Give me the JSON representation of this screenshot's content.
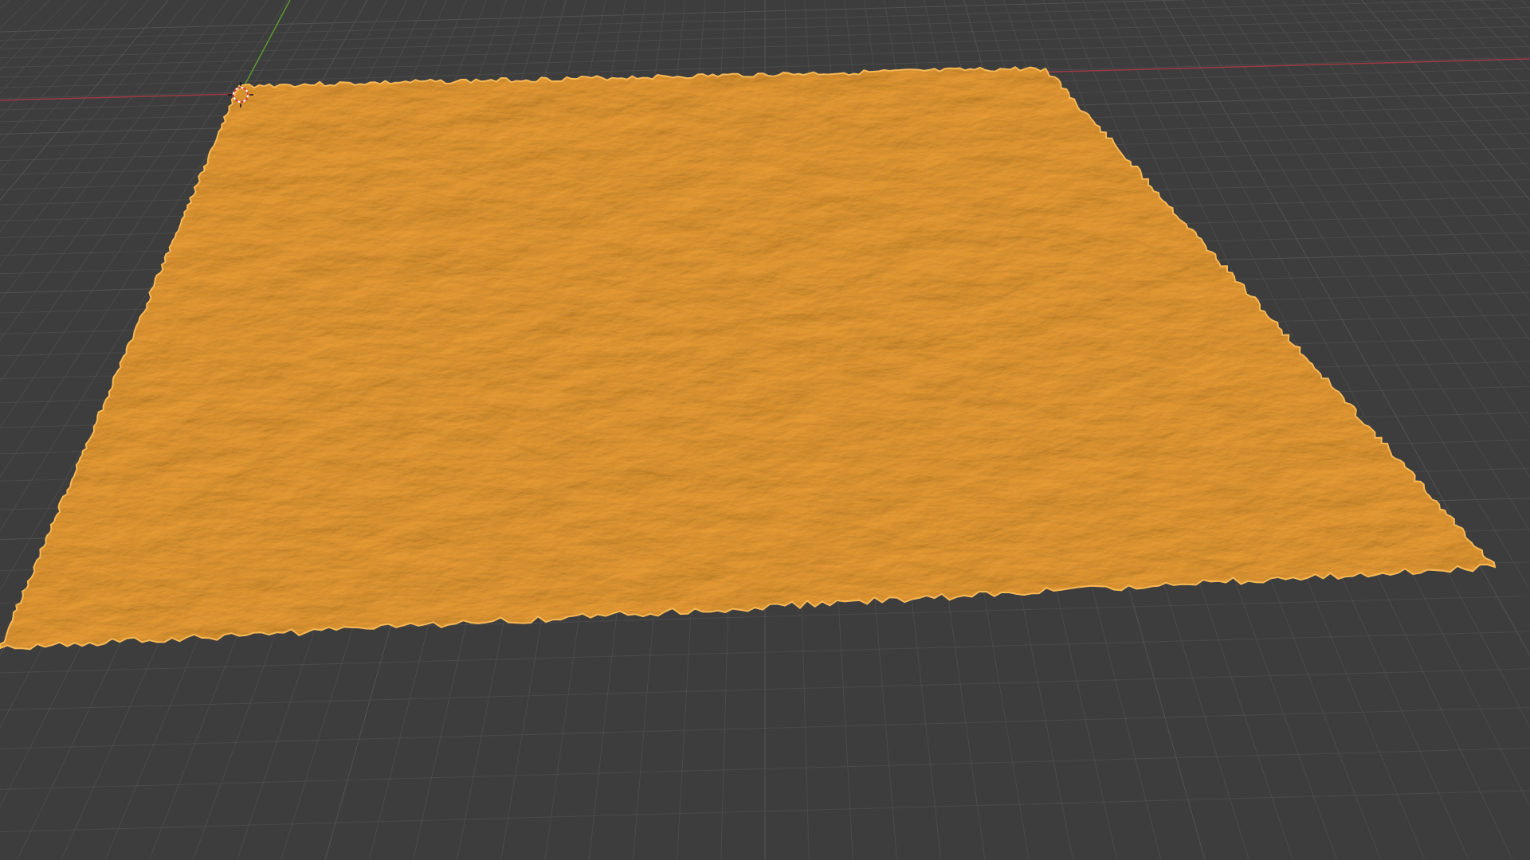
{
  "app": "3D viewport",
  "viewport": {
    "background_color": "#3d3d3d",
    "grid_color": "#4a4a4a",
    "grid_major_color": "#525252",
    "x_axis_color": "#9c3a45",
    "y_axis_color": "#5c9a2e",
    "selected_object_color": "#f0a033",
    "selected_object_shadow": "#c97a1a",
    "selected_object_highlight": "#f7b956",
    "object": {
      "type": "terrain-mesh",
      "selected": true
    },
    "cursor_icon": "3d-cursor-icon"
  }
}
